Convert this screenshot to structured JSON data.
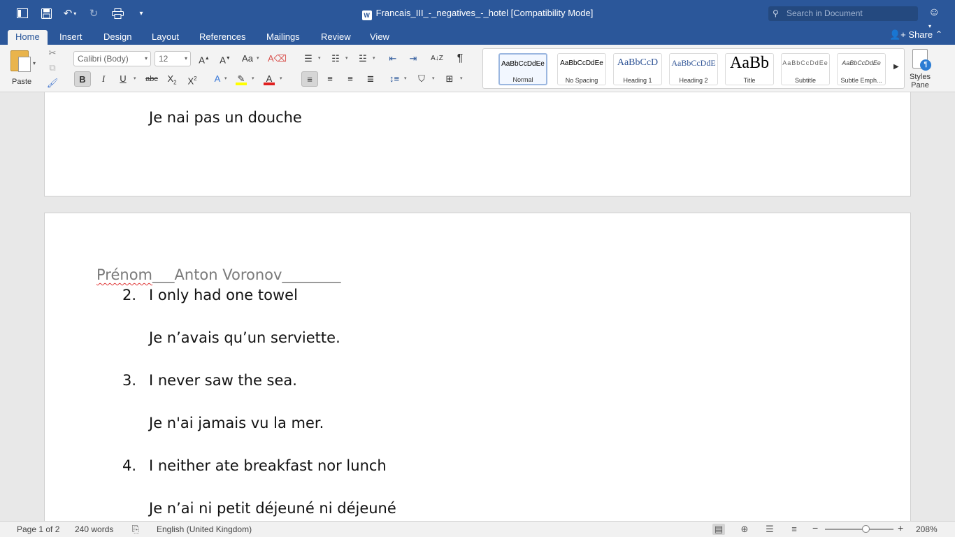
{
  "window": {
    "title": "Francais_III_-_negatives_-_hotel [Compatibility Mode]",
    "search_placeholder": "Search in Document"
  },
  "toolbar_icons": [
    "sidebar-toggle-icon",
    "save-icon",
    "undo-icon",
    "redo-icon",
    "print-icon",
    "customize-icon"
  ],
  "tabs": [
    {
      "label": "Home",
      "active": true
    },
    {
      "label": "Insert"
    },
    {
      "label": "Design"
    },
    {
      "label": "Layout"
    },
    {
      "label": "References"
    },
    {
      "label": "Mailings"
    },
    {
      "label": "Review"
    },
    {
      "label": "View"
    }
  ],
  "share_label": "Share",
  "ribbon": {
    "paste_label": "Paste",
    "font_name": "Calibri (Body)",
    "font_size": "12",
    "bold": "B",
    "italic": "I",
    "underline": "U",
    "strike": "abc",
    "highlight_color": "#ffff00",
    "font_color": "#e02020",
    "styles": [
      {
        "sample": "AaBbCcDdEe",
        "name": "Normal",
        "selected": true
      },
      {
        "sample": "AaBbCcDdEe",
        "name": "No Spacing"
      },
      {
        "sample": "AaBbCcD",
        "name": "Heading 1"
      },
      {
        "sample": "AaBbCcDdE",
        "name": "Heading 2"
      },
      {
        "sample": "AaBb",
        "name": "Title"
      },
      {
        "sample": "AaBbCcDdEe",
        "name": "Subtitle"
      },
      {
        "sample": "AaBbCcDdEe",
        "name": "Subtle Emph..."
      }
    ],
    "styles_pane_label": [
      "Styles",
      "Pane"
    ]
  },
  "document": {
    "page1_line": "Je nai pas un douche",
    "prenom_label": "Prénom",
    "prenom_value": "___Anton Voronov________",
    "items": [
      {
        "number": "2.",
        "question": "I only had one towel",
        "answer": "Je n’avais qu’un serviette."
      },
      {
        "number": "3.",
        "question": "I never saw the sea.",
        "answer": "Je n'ai jamais vu la mer."
      },
      {
        "number": "4.",
        "question": "I neither ate breakfast nor lunch",
        "answer": "Je n’ai ni petit déjeuné ni déjeuné"
      }
    ]
  },
  "status": {
    "page": "Page 1 of 2",
    "words": "240 words",
    "language": "English (United Kingdom)",
    "zoom": "208%",
    "zoom_minus": "−",
    "zoom_plus": "+"
  }
}
